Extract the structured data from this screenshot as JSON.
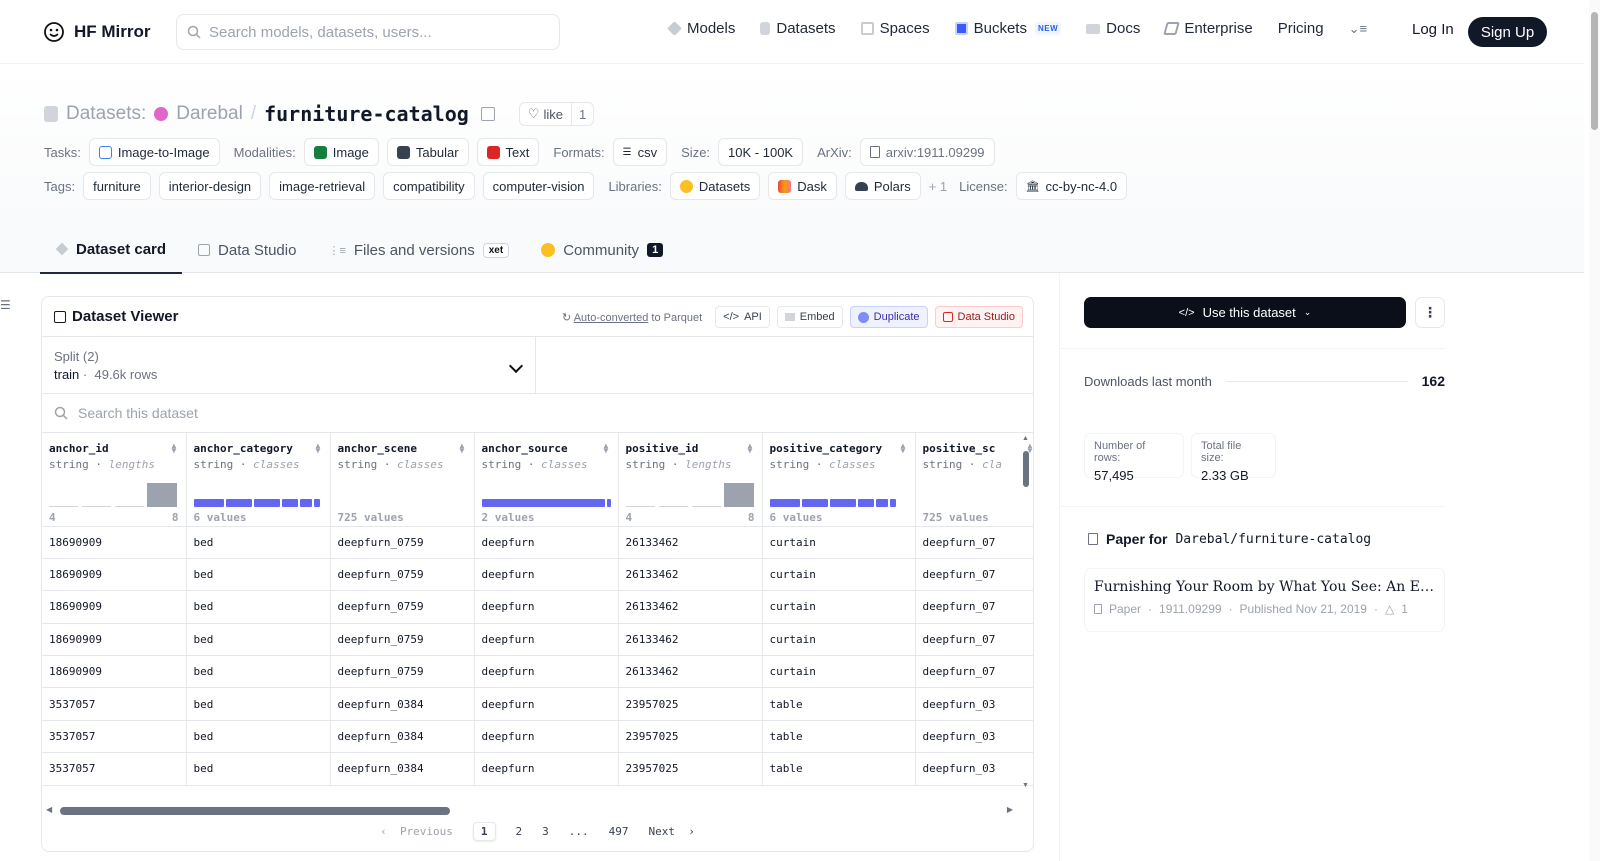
{
  "nav": {
    "brand": "HF Mirror",
    "search_placeholder": "Search models, datasets, users...",
    "links": {
      "models": "Models",
      "datasets": "Datasets",
      "spaces": "Spaces",
      "buckets": "Buckets",
      "buckets_badge": "NEW",
      "docs": "Docs",
      "enterprise": "Enterprise",
      "pricing": "Pricing"
    },
    "login": "Log In",
    "signup": "Sign Up"
  },
  "header": {
    "label": "Datasets:",
    "org": "Darebal",
    "slash": "/",
    "name": "furniture-catalog",
    "like_label": "like",
    "like_count": "1",
    "tasks_label": "Tasks:",
    "task": "Image-to-Image",
    "modalities_label": "Modalities:",
    "modalities": [
      "Image",
      "Tabular",
      "Text"
    ],
    "formats_label": "Formats:",
    "format": "csv",
    "size_label": "Size:",
    "size": "10K - 100K",
    "arxiv_label": "ArXiv:",
    "arxiv": "arxiv:1911.09299",
    "tags_label": "Tags:",
    "tags": [
      "furniture",
      "interior-design",
      "image-retrieval",
      "compatibility",
      "computer-vision"
    ],
    "libraries_label": "Libraries:",
    "libraries": [
      "Datasets",
      "Dask",
      "Polars"
    ],
    "libraries_more": "+ 1",
    "license_label": "License:",
    "license": "cc-by-nc-4.0"
  },
  "tabs": {
    "card": "Dataset card",
    "studio": "Data Studio",
    "files": "Files and versions",
    "xet": "xet",
    "community": "Community",
    "community_count": "1"
  },
  "viewer": {
    "title": "Dataset Viewer",
    "autoconv_link": "Auto-converted",
    "autoconv_rest": " to Parquet",
    "api": "API",
    "embed": "Embed",
    "duplicate": "Duplicate",
    "data_studio": "Data Studio",
    "split_label": "Split (2)",
    "split_value": "train",
    "split_rows": "49.6k rows",
    "search_placeholder": "Search this dataset",
    "columns": [
      {
        "name": "anchor_id",
        "type": "string",
        "stat": "lengths",
        "kind": "hist",
        "min": "4",
        "max": "8"
      },
      {
        "name": "anchor_category",
        "type": "string",
        "stat": "classes",
        "kind": "cls",
        "count": "6 values"
      },
      {
        "name": "anchor_scene",
        "type": "string",
        "stat": "classes",
        "kind": "none",
        "count": "725 values"
      },
      {
        "name": "anchor_source",
        "type": "string",
        "stat": "classes",
        "kind": "cls2",
        "count": "2 values"
      },
      {
        "name": "positive_id",
        "type": "string",
        "stat": "lengths",
        "kind": "hist",
        "min": "4",
        "max": "8"
      },
      {
        "name": "positive_category",
        "type": "string",
        "stat": "classes",
        "kind": "cls",
        "count": "6 values"
      },
      {
        "name": "positive_sc",
        "type": "string",
        "stat": "cla",
        "kind": "none",
        "count": "725 values"
      }
    ],
    "rows": [
      [
        "18690909",
        "bed",
        "deepfurn_0759",
        "deepfurn",
        "26133462",
        "curtain",
        "deepfurn_07"
      ],
      [
        "18690909",
        "bed",
        "deepfurn_0759",
        "deepfurn",
        "26133462",
        "curtain",
        "deepfurn_07"
      ],
      [
        "18690909",
        "bed",
        "deepfurn_0759",
        "deepfurn",
        "26133462",
        "curtain",
        "deepfurn_07"
      ],
      [
        "18690909",
        "bed",
        "deepfurn_0759",
        "deepfurn",
        "26133462",
        "curtain",
        "deepfurn_07"
      ],
      [
        "18690909",
        "bed",
        "deepfurn_0759",
        "deepfurn",
        "26133462",
        "curtain",
        "deepfurn_07"
      ],
      [
        "3537057",
        "bed",
        "deepfurn_0384",
        "deepfurn",
        "23957025",
        "table",
        "deepfurn_03"
      ],
      [
        "3537057",
        "bed",
        "deepfurn_0384",
        "deepfurn",
        "23957025",
        "table",
        "deepfurn_03"
      ],
      [
        "3537057",
        "bed",
        "deepfurn_0384",
        "deepfurn",
        "23957025",
        "table",
        "deepfurn_03"
      ]
    ],
    "pager": {
      "prev": "Previous",
      "pages": [
        "1",
        "2",
        "3",
        "...",
        "497"
      ],
      "next": "Next"
    }
  },
  "sidebar": {
    "use_button": "Use this dataset",
    "downloads_label": "Downloads last month",
    "downloads": "162",
    "rows_label": "Number of rows:",
    "rows": "57,495",
    "size_label": "Total file size:",
    "size": "2.33 GB",
    "paper_for": "Paper for",
    "paper_repo": "Darebal/furniture-catalog",
    "paper_title": "Furnishing Your Room by What You See: An End-to-End Furniture Set Retrieval Framework with Rich Annotated Benchmark Dataset",
    "paper_kind": "Paper",
    "paper_id": "1911.09299",
    "paper_date": "Published Nov 21, 2019",
    "paper_votes": "1"
  }
}
